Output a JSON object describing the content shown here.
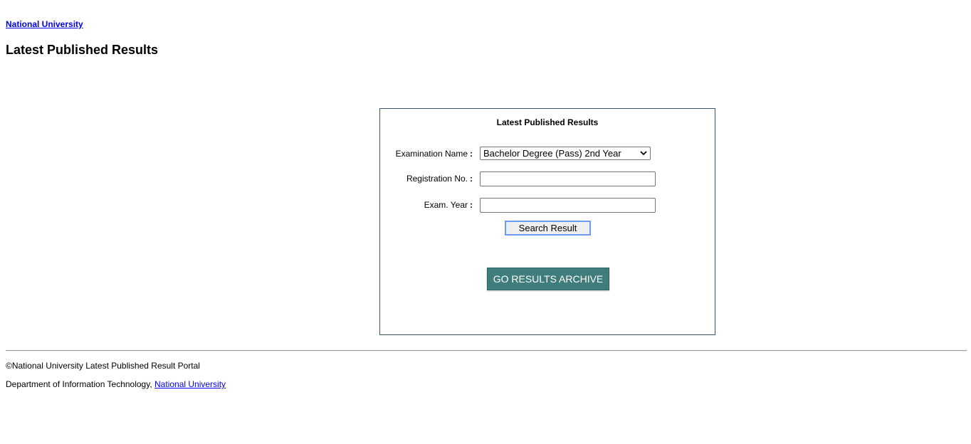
{
  "header": {
    "top_link": "National University",
    "page_title": "Latest Published Results"
  },
  "form": {
    "title": "Latest Published Results",
    "exam_name_label": "Examination Name",
    "exam_name_value": "Bachelor Degree (Pass) 2nd Year",
    "registration_label": "Registration No.",
    "registration_value": "",
    "exam_year_label": "Exam. Year",
    "exam_year_value": "",
    "label_colon": ":",
    "search_button": "Search Result",
    "archive_button": "GO RESULTS ARCHIVE"
  },
  "footer": {
    "copyright": "©National University Latest Published Result Portal",
    "department_text": "Department of Information Technology,",
    "department_link": "National University"
  },
  "colors": {
    "link": "#0000ee",
    "archive_button_bg": "#3e7d7b",
    "box_border": "#3b5573",
    "search_button_border": "#6a9cf5"
  },
  "icons": {
    "select_arrow": "chevron-down-icon"
  }
}
